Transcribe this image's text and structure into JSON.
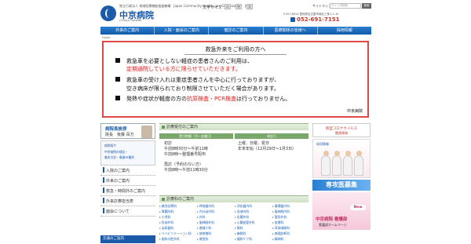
{
  "header": {
    "org_sub": "独立行政法人 地域医療機能推進機構　Japan Community Health care Organization　JCHO",
    "hospital_name": "中京病院",
    "hospital_en": "Chukyo Hospital",
    "font_size_label": "文字サイズ",
    "font_sizes": [
      "小",
      "中",
      "大"
    ],
    "sitemap": "サイトマップ",
    "search_placeholder": "サイト内検索",
    "search_button": "検索",
    "address": "〒457-8510 愛知県名古屋市南区三条1-1-10",
    "phone": "052-691-7151"
  },
  "gnav": [
    "外来のご案内",
    "入院・面会のご案内",
    "健診のご案内",
    "医療関係の皆様へ",
    "採用情報"
  ],
  "breadcrumb": "Home",
  "notice": {
    "title": "救急外来をご利用の方へ",
    "l1": "救急車を必要としない軽症の患者さんのご利用は、",
    "l2": "定期通院している方に限らせていただきます。",
    "l3": "救急車の受け入れは重症患者さんを中心に行っておりますが、",
    "l4": "空き病床が限られており制限させていただく場合があります。",
    "l5a": "発熱や症状が軽度の方の",
    "l5b": "抗原検査・PCR検査",
    "l5c": "は行っておりません。",
    "sign": "中京病院"
  },
  "sidebar": {
    "greet_title": "病院長挨拶",
    "greet_name": "院長　後藤 百万",
    "info1": "病院紹介",
    "info2": "中京病院の理念・",
    "info3": "基本方針・患者の権利",
    "links": [
      "入院のご案内",
      "外来のご案内",
      "救急・時間外のご案内",
      "外来診療担当表",
      "面会について"
    ],
    "sub": "交通のご案内"
  },
  "main": {
    "hours_head": "診療受付のご案内",
    "col1": "受付時間（月～金曜日）",
    "col2": "休診日",
    "hours_a": "初診\n午前8時30分～午前11時\n午前8時～整理番号配布",
    "hours_b": "土曜、日曜、祝日\n年末年始（12月29日～1月3日）",
    "hours_c": "再診（予約のない方）\n午前8時～午前11時30分",
    "dept_head": "診療科のご案内",
    "depts": [
      "総合診療科",
      "呼吸器内科",
      "消化器内科",
      "循環器内科",
      "腎臓内科",
      "内分泌内科",
      "血液内科",
      "脳神経内科",
      "小児科",
      "外科",
      "乳腺外科",
      "整形外科",
      "形成外科",
      "脳神経外科",
      "心臓血管外科",
      "皮膚科",
      "泌尿器科",
      "産婦人科",
      "眼科",
      "耳鼻咽喉科",
      "リハビリテーション科",
      "放射線科",
      "麻酔科",
      "病理診断科",
      "歯科口腔外科",
      "救急科",
      "緩和ケア科",
      "精神科"
    ]
  },
  "right": {
    "corona1": "新型コロナウイルス",
    "corona2": "関連情報",
    "rec_title": "採用情報",
    "recruit": "専攻医募集",
    "nurse_new": "New",
    "nurse_label": "中京病院 看護部",
    "nurse_sub": "看護部ホームページ"
  }
}
